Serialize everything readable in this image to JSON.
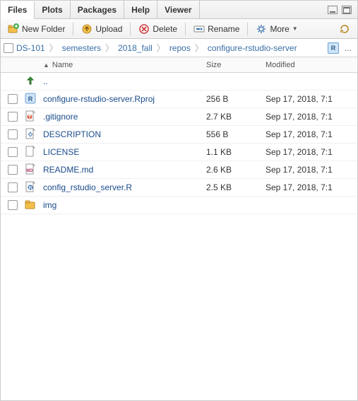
{
  "tabs": [
    "Files",
    "Plots",
    "Packages",
    "Help",
    "Viewer"
  ],
  "active_tab": 0,
  "toolbar": {
    "new_folder": "New Folder",
    "upload": "Upload",
    "delete": "Delete",
    "rename": "Rename",
    "more": "More"
  },
  "breadcrumb": {
    "items": [
      "DS-101",
      "semesters",
      "2018_fall",
      "repos",
      "configure-rstudio-server"
    ],
    "first_truncated": "DS-101"
  },
  "columns": {
    "name": "Name",
    "size": "Size",
    "modified": "Modified"
  },
  "parent_label": "..",
  "files": [
    {
      "icon": "rproj",
      "name": "configure-rstudio-server.Rproj",
      "size": "256 B",
      "modified": "Sep 17, 2018, 7:1"
    },
    {
      "icon": "git",
      "name": ".gitignore",
      "size": "2.7 KB",
      "modified": "Sep 17, 2018, 7:1"
    },
    {
      "icon": "gear",
      "name": "DESCRIPTION",
      "size": "556 B",
      "modified": "Sep 17, 2018, 7:1"
    },
    {
      "icon": "blank",
      "name": "LICENSE",
      "size": "1.1 KB",
      "modified": "Sep 17, 2018, 7:1"
    },
    {
      "icon": "md",
      "name": "README.md",
      "size": "2.6 KB",
      "modified": "Sep 17, 2018, 7:1"
    },
    {
      "icon": "rscript",
      "name": "config_rstudio_server.R",
      "size": "2.5 KB",
      "modified": "Sep 17, 2018, 7:1"
    },
    {
      "icon": "folder",
      "name": "img",
      "size": "",
      "modified": ""
    }
  ]
}
